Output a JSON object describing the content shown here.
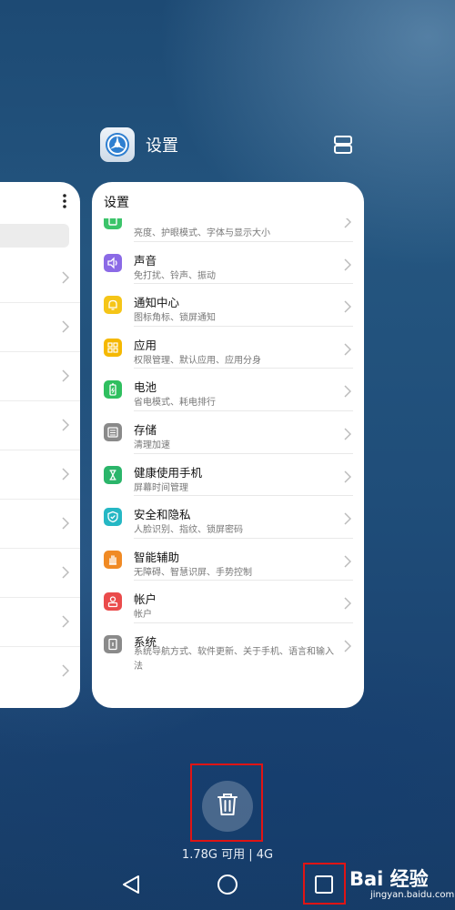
{
  "app": {
    "title": "设置",
    "icon": "settings-icon",
    "split_icon": "split-screen-icon"
  },
  "card": {
    "title": "设置",
    "items": [
      {
        "title": "",
        "subtitle": "亮度、护眼模式、字体与显示大小",
        "icon": "display-icon",
        "color": "#3cc46a"
      },
      {
        "title": "声音",
        "subtitle": "免打扰、铃声、振动",
        "icon": "sound-icon",
        "color": "#8b6ae6"
      },
      {
        "title": "通知中心",
        "subtitle": "图标角标、锁屏通知",
        "icon": "notification-icon",
        "color": "#f5c518"
      },
      {
        "title": "应用",
        "subtitle": "权限管理、默认应用、应用分身",
        "icon": "apps-icon",
        "color": "#f5b800"
      },
      {
        "title": "电池",
        "subtitle": "省电模式、耗电排行",
        "icon": "battery-icon",
        "color": "#2fbf5f"
      },
      {
        "title": "存储",
        "subtitle": "清理加速",
        "icon": "storage-icon",
        "color": "#8a8a8a"
      },
      {
        "title": "健康使用手机",
        "subtitle": "屏幕时间管理",
        "icon": "hourglass-icon",
        "color": "#2bb56a"
      },
      {
        "title": "安全和隐私",
        "subtitle": "人脸识别、指纹、锁屏密码",
        "icon": "shield-icon",
        "color": "#25b7c4"
      },
      {
        "title": "智能辅助",
        "subtitle": "无障碍、智慧识屏、手势控制",
        "icon": "hand-icon",
        "color": "#f08a24"
      },
      {
        "title": "帐户",
        "subtitle": "帐户",
        "icon": "account-icon",
        "color": "#ea4b4b"
      },
      {
        "title": "系统",
        "subtitle": "系统导航方式、软件更新、关于手机、语言和输入法",
        "icon": "system-icon",
        "color": "#8a8a8a"
      }
    ]
  },
  "bottom": {
    "memory_text": "1.78G 可用 | 4G",
    "trash_icon": "trash-icon",
    "nav": [
      "back-icon",
      "home-icon",
      "recent-apps-icon"
    ]
  },
  "watermark": {
    "logo": "Bai 经验",
    "url": "jingyan.baidu.com"
  },
  "colors": {
    "highlight": "#e01414",
    "card_bg": "#ffffff"
  }
}
